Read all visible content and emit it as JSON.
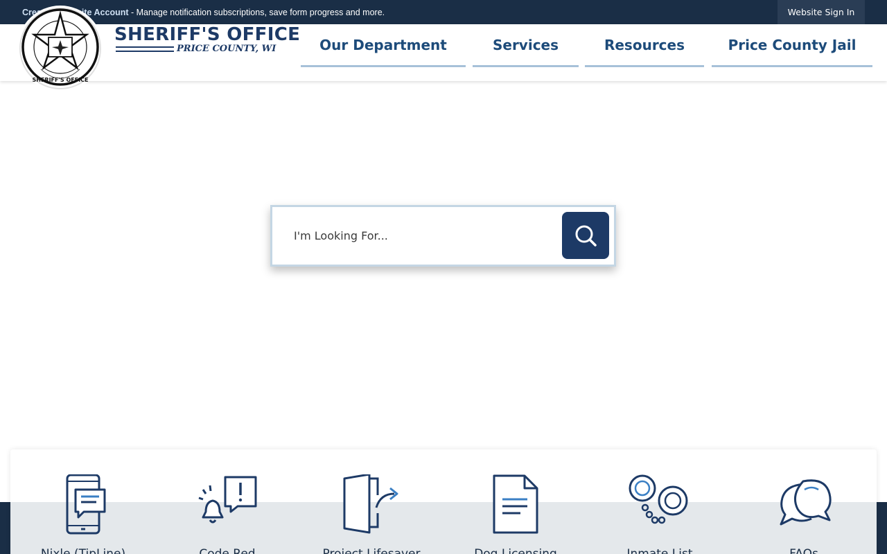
{
  "topbar": {
    "create_account_link": "Create a Website Account",
    "create_account_text": " - Manage notification subscriptions, save form progress and more.",
    "sign_in_label": "Website Sign In"
  },
  "logo": {
    "title": "SHERIFF'S OFFICE",
    "subtitle": "PRICE COUNTY, WI"
  },
  "nav": [
    {
      "label": "Our Department"
    },
    {
      "label": "Services"
    },
    {
      "label": "Resources"
    },
    {
      "label": "Price County Jail"
    }
  ],
  "search": {
    "placeholder": "I'm Looking For...",
    "button_icon": "search-icon"
  },
  "quick_links": [
    {
      "label": "Nixle (TipLine)",
      "icon": "phone-message-icon"
    },
    {
      "label": "Code Red",
      "icon": "alert-bell-icon"
    },
    {
      "label": "Project Lifesaver",
      "icon": "door-share-icon"
    },
    {
      "label": "Dog Licensing",
      "icon": "document-icon"
    },
    {
      "label": "Inmate List",
      "icon": "handcuffs-icon"
    },
    {
      "label": "FAQs",
      "icon": "chat-bubbles-icon"
    }
  ],
  "colors": {
    "navy": "#1a2e46",
    "brand_blue": "#1d3a66",
    "nav_underline": "#a7c1d9"
  }
}
